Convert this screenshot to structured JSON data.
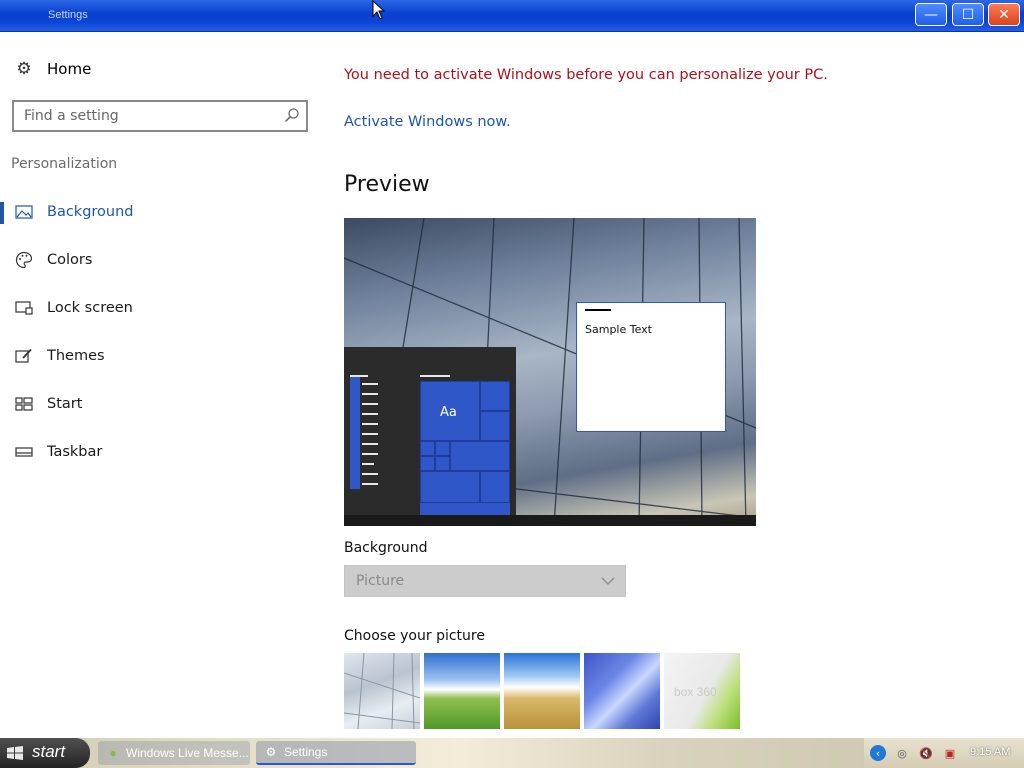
{
  "window": {
    "title": "Settings",
    "controls": {
      "minimize": "—",
      "maximize": "☐",
      "close": "✕"
    }
  },
  "sidebar": {
    "home_label": "Home",
    "search": {
      "placeholder": "Find a setting"
    },
    "section_label": "Personalization",
    "items": [
      {
        "label": "Background",
        "icon": "picture-icon",
        "active": true
      },
      {
        "label": "Colors",
        "icon": "palette-icon",
        "active": false
      },
      {
        "label": "Lock screen",
        "icon": "lock-screen-icon",
        "active": false
      },
      {
        "label": "Themes",
        "icon": "brush-icon",
        "active": false
      },
      {
        "label": "Start",
        "icon": "start-tiles-icon",
        "active": false
      },
      {
        "label": "Taskbar",
        "icon": "taskbar-icon",
        "active": false
      }
    ]
  },
  "main": {
    "activation_message": "You need to activate Windows before you can personalize your PC.",
    "activate_link": "Activate Windows now.",
    "preview_title": "Preview",
    "preview": {
      "sample_text": "Sample Text",
      "tile_label": "Aa"
    },
    "background_label": "Background",
    "background_value": "Picture",
    "choose_picture_label": "Choose your picture",
    "thumbnails": [
      {
        "name": "glass-wall"
      },
      {
        "name": "green-hill"
      },
      {
        "name": "wheat-field"
      },
      {
        "name": "blue-abstract"
      },
      {
        "name": "xbox-360",
        "text": "box 360"
      }
    ]
  },
  "taskbar": {
    "start_label": "start",
    "items": [
      {
        "label": "Windows Live Messe..."
      },
      {
        "label": "Settings"
      }
    ],
    "clock": "9:15 AM"
  },
  "colors": {
    "accent": "#1f56a8",
    "warning": "#b0101a",
    "titlebar": "#0b44d6"
  }
}
